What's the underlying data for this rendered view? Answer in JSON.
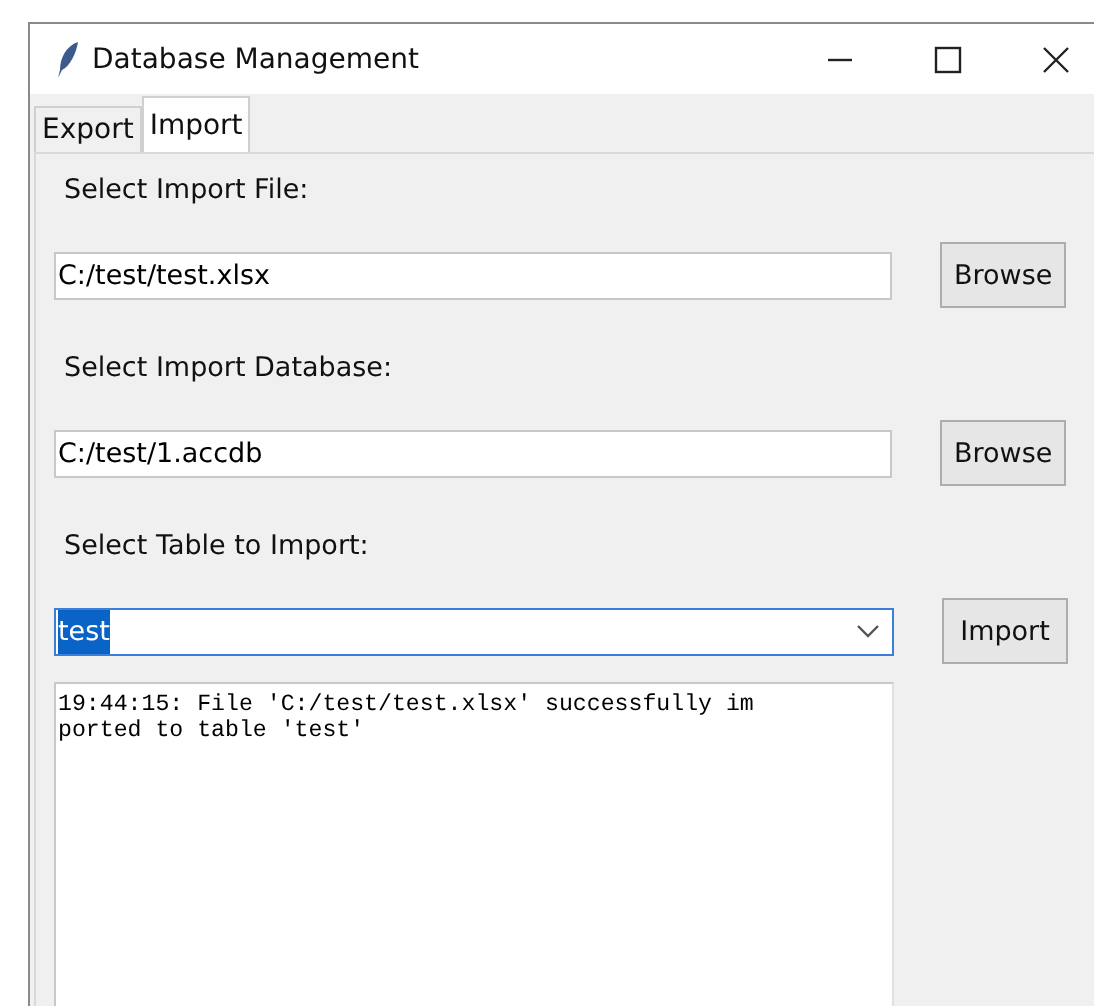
{
  "window": {
    "title": "Database Management"
  },
  "tabs": [
    {
      "label": "Export",
      "selected": false
    },
    {
      "label": "Import",
      "selected": true
    }
  ],
  "rows": [
    {
      "label": "Select Import File:",
      "kind": "entry",
      "value": "C:/test/test.xlsx",
      "button": "Browse"
    },
    {
      "label": "Select Import Database:",
      "kind": "entry",
      "value": "C:/test/1.accdb",
      "button": "Browse"
    },
    {
      "label": "Select Table to Import:",
      "kind": "combo",
      "value": "test",
      "button": "Import"
    }
  ],
  "log": {
    "lines": [
      "19:44:15: File 'C:/test/test.xlsx' successfully im",
      "ported to table 'test'"
    ]
  }
}
